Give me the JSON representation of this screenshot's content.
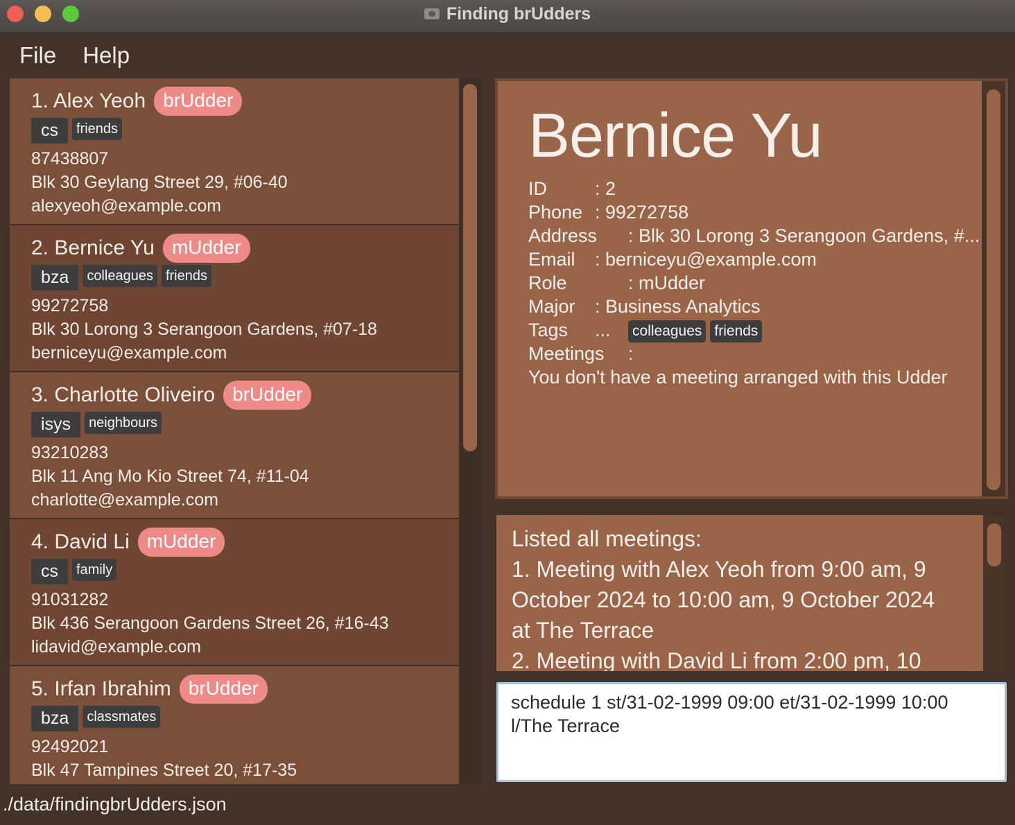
{
  "window": {
    "title": "Finding brUdders"
  },
  "menu": {
    "file": "File",
    "help": "Help"
  },
  "persons": [
    {
      "index": "1.",
      "name": "Alex Yeoh",
      "role": "brUdder",
      "major": "cs",
      "tags": [
        "friends"
      ],
      "phone": "87438807",
      "address": "Blk 30 Geylang Street 29, #06-40",
      "email": "alexyeoh@example.com"
    },
    {
      "index": "2.",
      "name": "Bernice Yu",
      "role": "mUdder",
      "major": "bza",
      "tags": [
        "colleagues",
        "friends"
      ],
      "phone": "99272758",
      "address": "Blk 30 Lorong 3 Serangoon Gardens, #07-18",
      "email": "berniceyu@example.com"
    },
    {
      "index": "3.",
      "name": "Charlotte Oliveiro",
      "role": "brUdder",
      "major": "isys",
      "tags": [
        "neighbours"
      ],
      "phone": "93210283",
      "address": "Blk 11 Ang Mo Kio Street 74, #11-04",
      "email": "charlotte@example.com"
    },
    {
      "index": "4.",
      "name": "David Li",
      "role": "mUdder",
      "major": "cs",
      "tags": [
        "family"
      ],
      "phone": "91031282",
      "address": "Blk 436 Serangoon Gardens Street 26, #16-43",
      "email": "lidavid@example.com"
    },
    {
      "index": "5.",
      "name": "Irfan Ibrahim",
      "role": "brUdder",
      "major": "bza",
      "tags": [
        "classmates"
      ],
      "phone": "92492021",
      "address": "Blk 47 Tampines Street 20, #17-35",
      "email": ""
    }
  ],
  "detail": {
    "name": "Bernice Yu",
    "rows": {
      "id_label": "ID",
      "id_sep": ": 2",
      "phone_label": "Phone",
      "phone_sep": ": 99272758",
      "address_label": "Address",
      "address_sep": ": Blk 30 Lorong 3 Serangoon Gardens, #...",
      "email_label": "Email",
      "email_sep": ": berniceyu@example.com",
      "role_label": "Role",
      "role_sep": ": mUdder",
      "major_label": "Major",
      "major_sep": ": Business Analytics",
      "tags_label": "Tags",
      "tags_sep": "...",
      "meetings_label": "Meetings",
      "meetings_sep": ":"
    },
    "tags": [
      "colleagues",
      "friends"
    ],
    "meeting_note": "You don't have a meeting arranged with this Udder"
  },
  "result": {
    "lines": [
      "Listed all meetings:",
      "1. Meeting with Alex Yeoh from 9:00 am, 9",
      "October 2024 to 10:00 am, 9 October 2024",
      "at The Terrace",
      "2. Meeting with David Li from 2:00 pm, 10"
    ]
  },
  "command": {
    "value": "schedule 1 st/31-02-1999 09:00 et/31-02-1999 10:00 l/The Terrace"
  },
  "status": {
    "path": "./data/findingbrUdders.json"
  }
}
